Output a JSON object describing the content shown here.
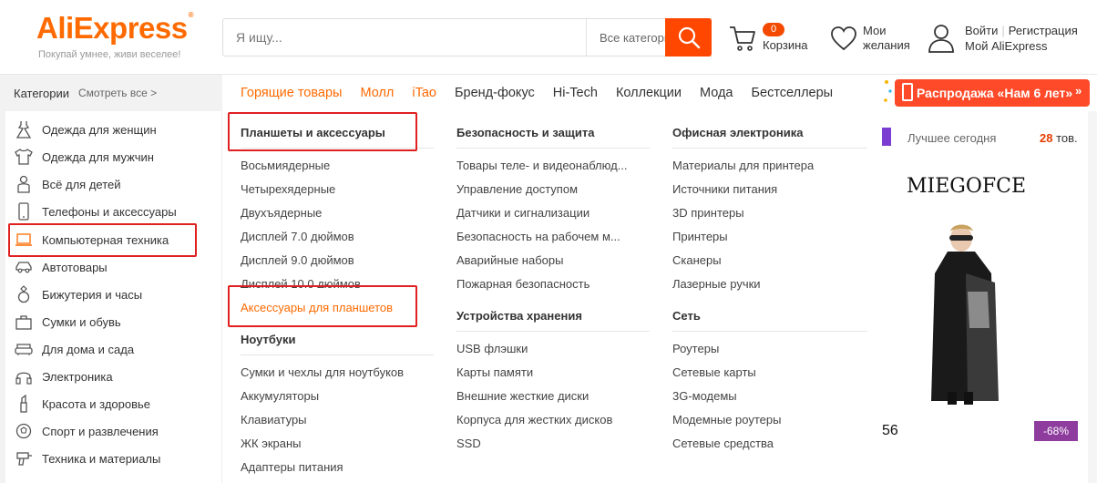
{
  "header": {
    "logo": "AliExpress",
    "tagline": "Покупай умнее, живи веселее!",
    "search_placeholder": "Я ищу...",
    "search_category": "Все категории",
    "cart_count": "0",
    "cart_label": "Корзина",
    "wishlist_line1": "Мои",
    "wishlist_line2": "желания",
    "login": "Войти",
    "register": "Регистрация",
    "my_account": "Мой AliExpress"
  },
  "nav": {
    "categories": "Категории",
    "see_all": "Смотреть все >",
    "links": [
      "Горящие товары",
      "Молл",
      "iTao",
      "Бренд-фокус",
      "Hi-Tech",
      "Коллекции",
      "Мода",
      "Бестселлеры"
    ],
    "promo": "Распродажа «Нам 6 лет»",
    "promo_arrow": "»"
  },
  "sidebar": {
    "items": [
      {
        "label": "Одежда для женщин",
        "icon": "dress-icon"
      },
      {
        "label": "Одежда для мужчин",
        "icon": "shirt-icon"
      },
      {
        "label": "Всё для детей",
        "icon": "baby-icon"
      },
      {
        "label": "Телефоны и аксессуары",
        "icon": "phone-icon"
      },
      {
        "label": "Компьютерная техника",
        "icon": "laptop-icon"
      },
      {
        "label": "Автотовары",
        "icon": "car-icon"
      },
      {
        "label": "Бижутерия и часы",
        "icon": "ring-icon"
      },
      {
        "label": "Сумки и обувь",
        "icon": "bag-icon"
      },
      {
        "label": "Для дома и сада",
        "icon": "sofa-icon"
      },
      {
        "label": "Электроника",
        "icon": "headphones-icon"
      },
      {
        "label": "Красота и здоровье",
        "icon": "lipstick-icon"
      },
      {
        "label": "Спорт и развлечения",
        "icon": "ball-icon"
      },
      {
        "label": "Техника и материалы",
        "icon": "drill-icon"
      }
    ]
  },
  "panel": {
    "col1": {
      "head": "Планшеты и аксессуары",
      "links": [
        "Восьмиядерные",
        "Четырехядерные",
        "Двухъядерные",
        "Дисплей 7.0 дюймов",
        "Дисплей 9.0 дюймов",
        "Дисплей 10.0 дюймов",
        "Аксессуары для планшетов"
      ],
      "head2": "Ноутбуки",
      "links2": [
        "Сумки и чехлы для ноутбуков",
        "Аккумуляторы",
        "Клавиатуры",
        "ЖК экраны",
        "Адаптеры питания"
      ]
    },
    "col2": {
      "head": "Безопасность и защита",
      "links": [
        "Товары теле- и видеонаблюд...",
        "Управление доступом",
        "Датчики и сигнализации",
        "Безопасность на рабочем м...",
        "Аварийные наборы",
        "Пожарная безопасность"
      ],
      "head2": "Устройства хранения",
      "links2": [
        "USB флэшки",
        "Карты памяти",
        "Внешние жесткие диски",
        "Корпуса для жестких дисков",
        "SSD"
      ]
    },
    "col3": {
      "head": "Офисная электроника",
      "links": [
        "Материалы для принтера",
        "Источники питания",
        "3D принтеры",
        "Принтеры",
        "Сканеры",
        "Лазерные ручки"
      ],
      "head2": "Сеть",
      "links2": [
        "Роутеры",
        "Сетевые карты",
        "3G-модемы",
        "Модемные роутеры",
        "Сетевые средства"
      ]
    }
  },
  "right": {
    "best_today": "Лучшее сегодня",
    "count": "28",
    "count_unit": "тов.",
    "brand": "MIEGOFCE",
    "price_tail": "56",
    "discount": "-68%"
  },
  "colors": {
    "accent": "#ff6a00",
    "search_button": "#ff4700",
    "highlight": "#e02020",
    "discount": "#8e3d9e"
  }
}
